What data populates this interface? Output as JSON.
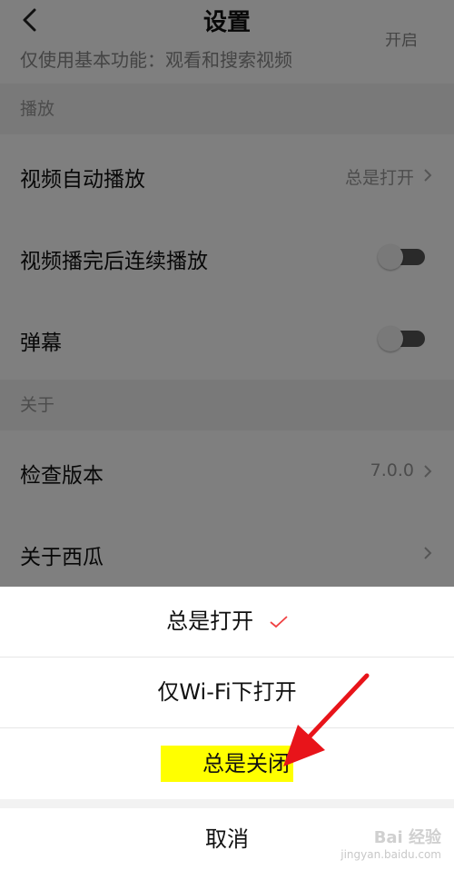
{
  "header": {
    "title": "设置",
    "partial_text": "仅使用基本功能：观看和搜索视频",
    "partial_right": "开启"
  },
  "sections": [
    {
      "title": "播放",
      "rows": [
        {
          "label": "视频自动播放",
          "value": "总是打开",
          "type": "nav"
        },
        {
          "label": "视频播完后连续播放",
          "type": "toggle",
          "on": false
        },
        {
          "label": "弹幕",
          "type": "toggle",
          "on": false
        }
      ]
    },
    {
      "title": "关于",
      "rows": [
        {
          "label": "检查版本",
          "value": "7.0.0",
          "type": "nav"
        },
        {
          "label": "关于西瓜",
          "type": "nav"
        }
      ]
    }
  ],
  "sheet": {
    "options": [
      {
        "label": "总是打开",
        "selected": true
      },
      {
        "label": "仅Wi-Fi下打开",
        "selected": false
      },
      {
        "label": "总是关闭",
        "selected": false,
        "highlighted": true
      }
    ],
    "cancel_label": "取消",
    "check_color": "#f04142",
    "highlight_color": "#ffff00"
  },
  "annotation": {
    "arrow_color": "#e8141a"
  },
  "watermark": {
    "text": "Bai 经验",
    "sub": "jingyan.baidu.com"
  }
}
